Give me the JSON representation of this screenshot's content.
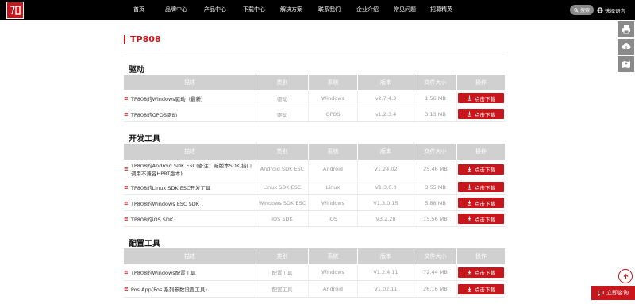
{
  "header": {
    "nav": [
      "首页",
      "品牌中心",
      "产品中心",
      "下载中心",
      "解决方案",
      "联系我们",
      "企业介绍",
      "常见问题",
      "招募精英"
    ],
    "search_label": "搜索",
    "lang_label": "选择语言"
  },
  "page": {
    "title": "TP808"
  },
  "columns": [
    "描述",
    "类别",
    "系统",
    "版本",
    "文件大小",
    "操作"
  ],
  "download_label": "点击下载",
  "sections": [
    {
      "title": "驱动",
      "rows": [
        {
          "desc": "TP808的Windows驱动（最新）",
          "type": "驱动",
          "system": "Windows",
          "version": "v2.7.4.3",
          "size": "1.56 MB"
        },
        {
          "desc": "TP808的OPOS驱动",
          "type": "驱动",
          "system": "OPOS",
          "version": "v1.2.3.4",
          "size": "3.13 MB"
        }
      ]
    },
    {
      "title": "开发工具",
      "rows": [
        {
          "desc": "TP808的Android SDK ESC(备注：新版本SDK,接口调用不兼容HPRT版本)",
          "type": "Android SDK ESC",
          "system": "Android",
          "version": "V1.24.02",
          "size": "25.46 MB"
        },
        {
          "desc": "TP808的Linux SDK ESC开发工具",
          "type": "Linux SDK ESC",
          "system": "Linux",
          "version": "V1.3.0.0",
          "size": "3.55 MB"
        },
        {
          "desc": "TP808的Windows ESC SDK",
          "type": "Windows SDK ESC",
          "system": "Windows",
          "version": "V1.3.0.15",
          "size": "5.88 MB"
        },
        {
          "desc": "TP808的iOS SDK",
          "type": "iOS SDK",
          "system": "iOS",
          "version": "V3.2.28",
          "size": "15.56 MB"
        }
      ]
    },
    {
      "title": "配置工具",
      "rows": [
        {
          "desc": "TP808的Windows配置工具",
          "type": "配置工具",
          "system": "Windows",
          "version": "V1.2.4.11",
          "size": "72.44 MB"
        },
        {
          "desc": "Pos App(Pos 系列参数设置工具)",
          "type": "配置工具",
          "system": "Android",
          "version": "V1.02.11",
          "size": "26.16 MB"
        }
      ]
    }
  ],
  "consult_label": "立即咨询",
  "icons": {
    "logo": "brand-logo-icon",
    "search": "search-icon",
    "globe": "globe-icon",
    "printer": "printer-icon",
    "cloud_download": "cloud-download-icon",
    "map": "map-icon",
    "to_top": "arrow-up-icon",
    "chat": "chat-icon",
    "download": "download-icon"
  },
  "colors": {
    "accent": "#c8161d",
    "nav_bg": "#000000",
    "header_bg": "#d0d0d0"
  }
}
